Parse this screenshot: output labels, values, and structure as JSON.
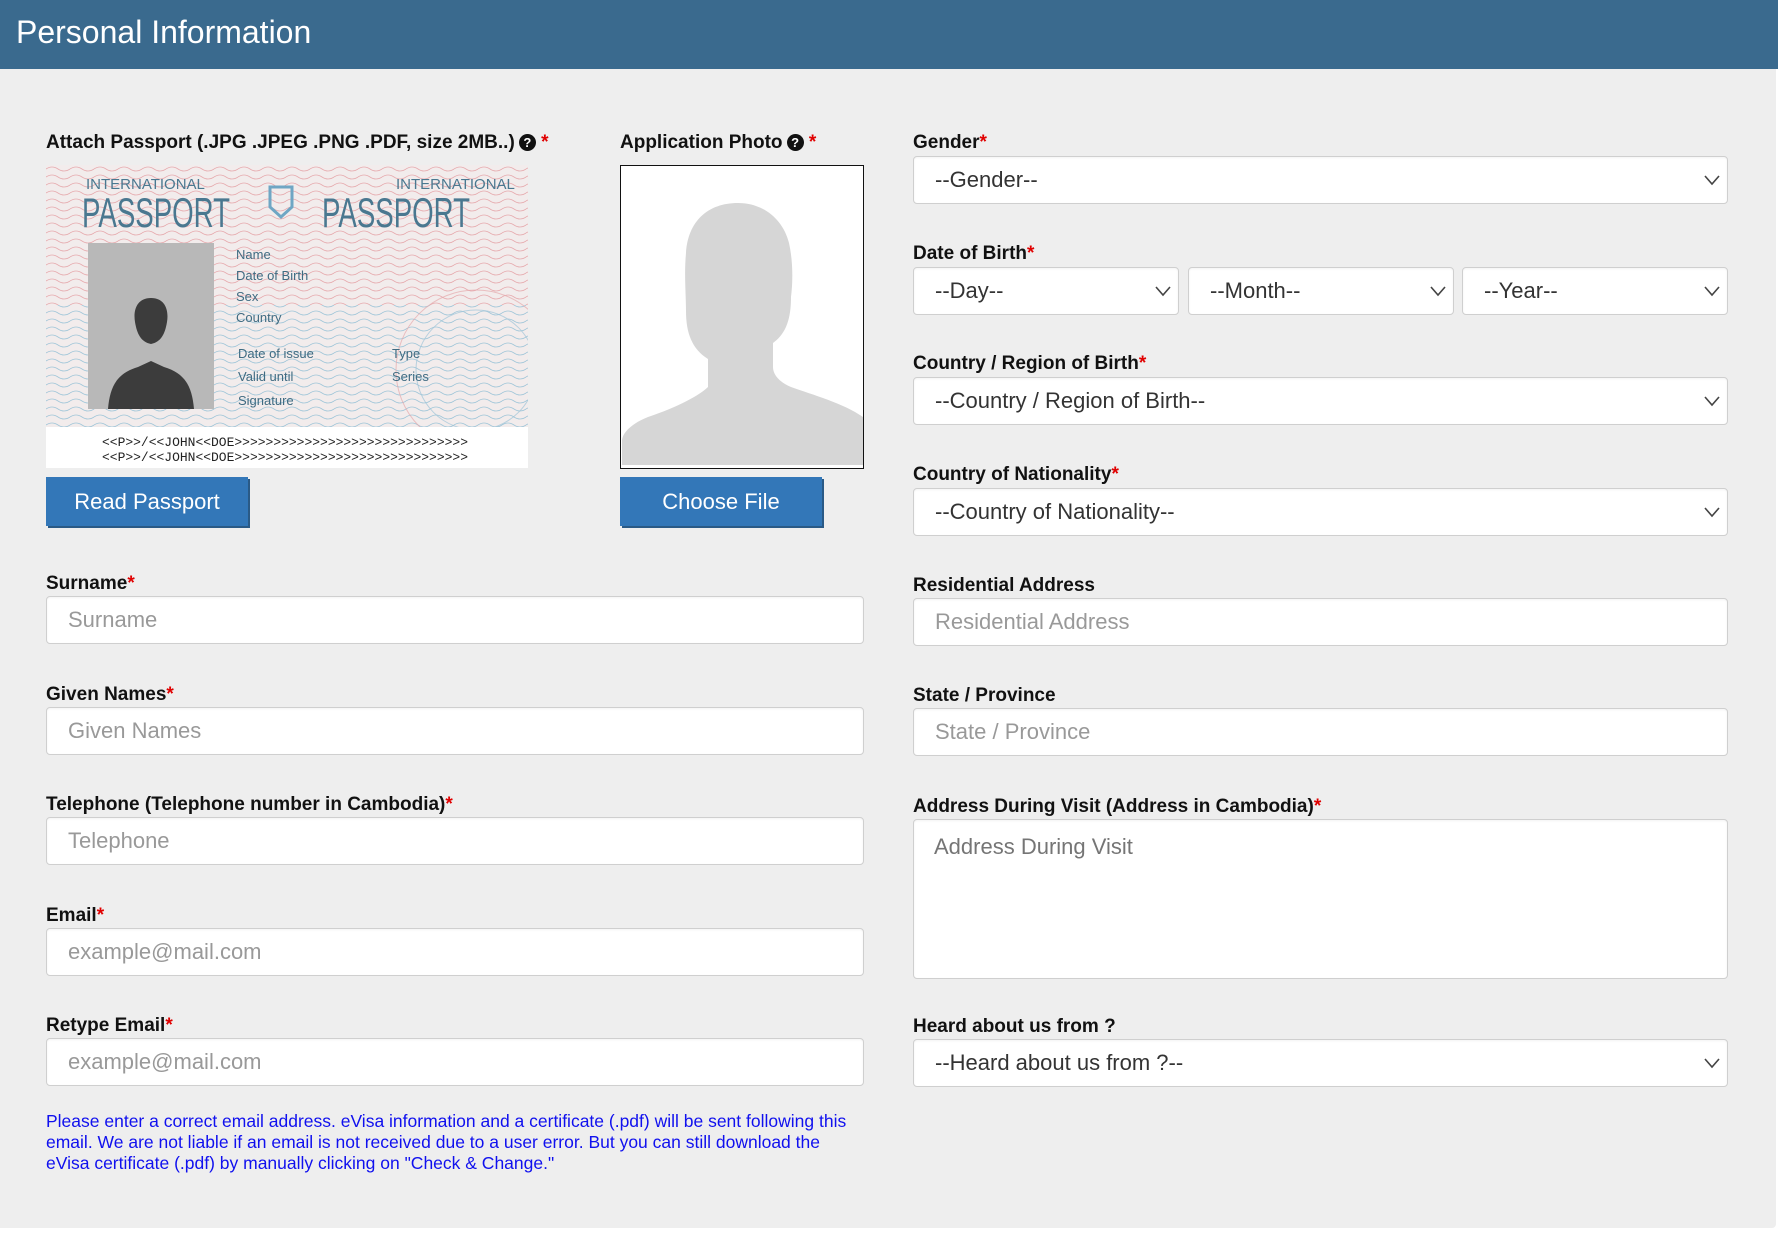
{
  "header": {
    "title": "Personal Information"
  },
  "colors": {
    "header_bg": "#3a6a8e",
    "button_bg": "#3377b8",
    "required": "#e00000",
    "note_text": "#1010ee"
  },
  "passport": {
    "label": "Attach Passport (.JPG .JPEG .PNG .PDF, size 2MB..)",
    "image_text": {
      "international": "INTERNATIONAL",
      "passport": "PASSPORT",
      "name": "Name",
      "dob": "Date of Birth",
      "sex": "Sex",
      "country": "Country",
      "issue": "Date of issue",
      "valid": "Valid until",
      "signature": "Signature",
      "type": "Type",
      "series": "Series",
      "mrz1": "<<P>>/<<JOHN<<DOE>>>>>>>>>>>>>>>>>>>>>>>>>>>>>>",
      "mrz2": "<<P>>/<<JOHN<<DOE>>>>>>>>>>>>>>>>>>>>>>>>>>>>>>"
    },
    "button": "Read Passport"
  },
  "photo": {
    "label": "Application Photo",
    "button": "Choose File"
  },
  "help_icon": "question-circle-icon",
  "required_mark": "*",
  "left": {
    "surname": {
      "label": "Surname",
      "placeholder": "Surname"
    },
    "given": {
      "label": "Given Names",
      "placeholder": "Given Names"
    },
    "phone": {
      "label": "Telephone (Telephone number in Cambodia)",
      "placeholder": "Telephone"
    },
    "email": {
      "label": "Email",
      "placeholder": "example@mail.com"
    },
    "email2": {
      "label": "Retype Email",
      "placeholder": "example@mail.com"
    },
    "note": "Please enter a correct email address. eVisa information and a certificate (.pdf) will be sent following this email. We are not liable if an email is not received due to a user error. But you can still download the eVisa certificate (.pdf) by manually clicking on \"Check & Change.\""
  },
  "right": {
    "gender": {
      "label": "Gender",
      "value": "--Gender--"
    },
    "dob": {
      "label": "Date of Birth",
      "day": "--Day--",
      "month": "--Month--",
      "year": "--Year--"
    },
    "birth_country": {
      "label": "Country / Region of Birth",
      "value": "--Country / Region of Birth--"
    },
    "nationality": {
      "label": "Country of Nationality",
      "value": "--Country of Nationality--"
    },
    "residential": {
      "label": "Residential Address",
      "placeholder": "Residential Address"
    },
    "state": {
      "label": "State / Province",
      "placeholder": "State / Province"
    },
    "visit_address": {
      "label": "Address During Visit (Address in Cambodia)",
      "placeholder": "Address During Visit"
    },
    "heard": {
      "label": "Heard about us from ?",
      "value": "--Heard about us from ?--"
    }
  }
}
